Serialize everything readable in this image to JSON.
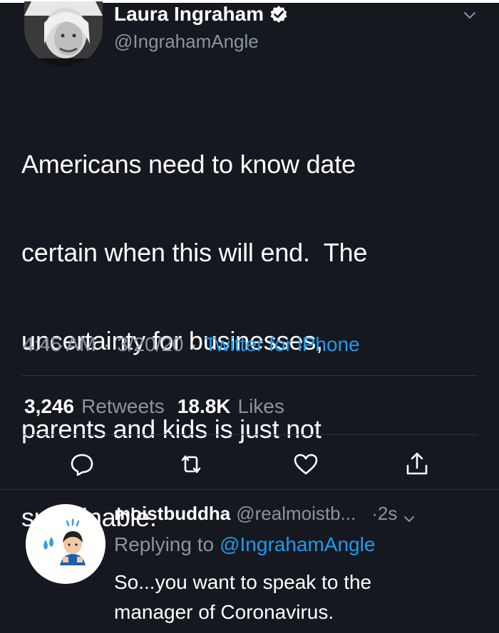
{
  "tweet": {
    "author": {
      "display_name": "Laura Ingraham",
      "handle": "@IngrahamAngle",
      "verified": true
    },
    "text_lines": [
      "Americans need to know date",
      "certain when this will end.  The",
      "uncertainty for businesses,",
      "parents and kids is just not",
      "sustainable."
    ],
    "time": "4:45 AM",
    "date": "3/20/20",
    "source": "Twitter for iPhone",
    "separator": "·",
    "stats": {
      "retweets_count": "3,246",
      "retweets_label": "Retweets",
      "likes_count": "18.8K",
      "likes_label": "Likes"
    },
    "actions": [
      "reply-icon",
      "retweet-icon",
      "like-icon",
      "share-icon"
    ]
  },
  "reply": {
    "display_name": "moistbuddha",
    "handle": "@realmoistb...",
    "time": "·2s",
    "replying_label": "Replying to",
    "replying_handle": "@IngrahamAngle",
    "text_lines": [
      "So...you want to speak to the",
      "manager of Coronavirus."
    ]
  },
  "colors": {
    "background": "#15181f",
    "link": "#1d9bf0",
    "secondary_text": "#8b949e"
  }
}
